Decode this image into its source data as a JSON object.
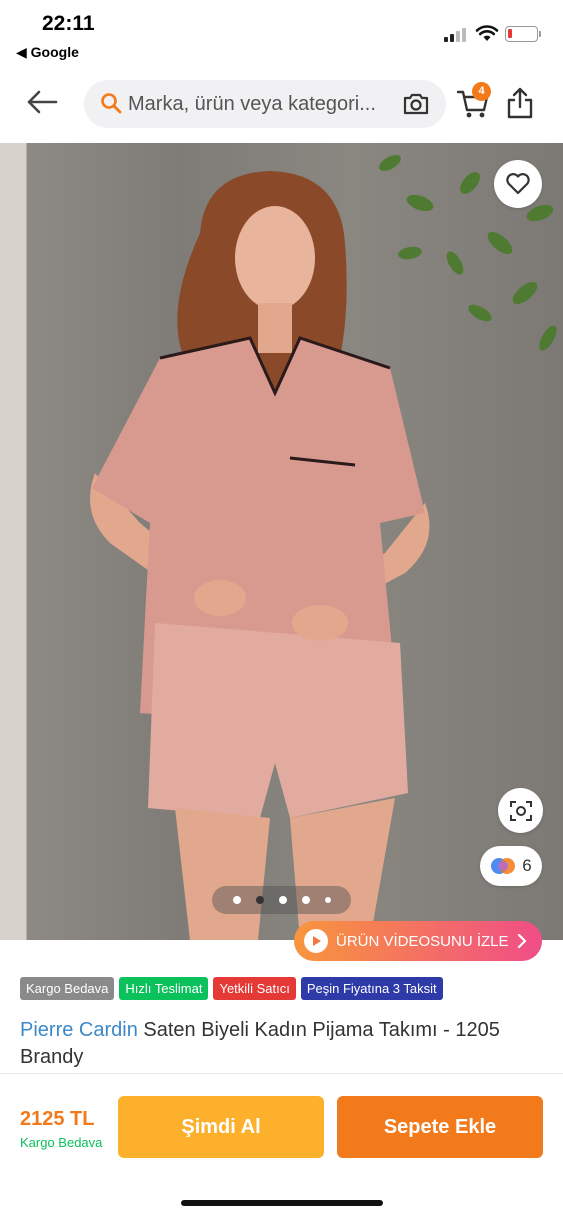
{
  "status_bar": {
    "time": "22:11",
    "back_app": "◀ Google",
    "battery_color": "#e53935"
  },
  "header": {
    "back_icon": "arrow-left-icon",
    "search_placeholder": "Marka, ürün veya kategori...",
    "search_icon": "search-icon",
    "camera_icon": "camera-search-icon",
    "cart_icon": "cart-icon",
    "cart_count": "4",
    "share_icon": "share-icon"
  },
  "gallery": {
    "favorite_icon": "heart-icon",
    "visual_search_icon": "visual-search-icon",
    "color_options_count": "6",
    "slide_count": 5,
    "active_slide": 2,
    "video_button_label": "ÜRÜN VİDEOSUNU İZLE"
  },
  "badges": [
    {
      "label": "Kargo Bedava",
      "color": "#8a8a8a"
    },
    {
      "label": "Hızlı Teslimat",
      "color": "#0bc15c"
    },
    {
      "label": "Yetkili Satıcı",
      "color": "#e53935"
    },
    {
      "label": "Peşin Fiyatına 3 Taksit",
      "color": "#2d3aa8"
    }
  ],
  "product": {
    "brand": "Pierre Cardin",
    "name": " Saten Biyeli Kadın Pijama Takımı - 1205 Brandy"
  },
  "bottom_bar": {
    "price": "2125 TL",
    "shipping": "Kargo Bedava",
    "buy_now_label": "Şimdi Al",
    "add_to_cart_label": "Sepete Ekle"
  },
  "colors": {
    "accent_orange": "#f27a1a",
    "buy_now_yellow": "#fdb02c",
    "brand_blue": "#3d88c9",
    "green": "#0bc15c"
  }
}
